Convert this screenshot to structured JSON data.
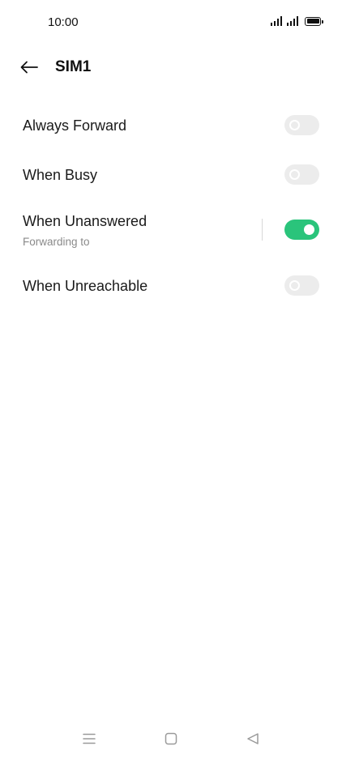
{
  "status_bar": {
    "time": "10:00",
    "icons": [
      "signal-icon",
      "signal-icon",
      "battery-icon"
    ]
  },
  "header": {
    "title": "SIM1",
    "back_icon": "arrow-left-icon"
  },
  "forwarding_options": [
    {
      "label": "Always Forward",
      "subtitle": "",
      "enabled": false
    },
    {
      "label": "When Busy",
      "subtitle": "",
      "enabled": false
    },
    {
      "label": "When Unanswered",
      "subtitle": "Forwarding to",
      "enabled": true
    },
    {
      "label": "When Unreachable",
      "subtitle": "",
      "enabled": false
    }
  ],
  "nav_bar": {
    "buttons": [
      "menu-icon",
      "home-icon",
      "back-triangle-icon"
    ]
  },
  "colors": {
    "toggle_on": "#2ac47b",
    "toggle_off": "#ececec",
    "subtitle": "#8a8a8a"
  }
}
